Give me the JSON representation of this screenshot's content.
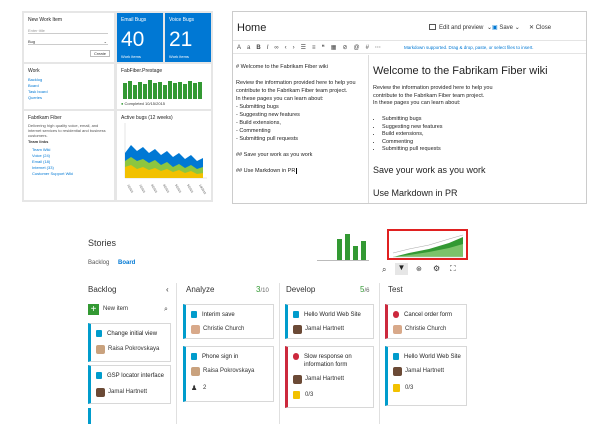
{
  "dashboard": {
    "new_work_item": {
      "title": "New Work Item",
      "placeholder": "Enter title",
      "type": "Bug",
      "button": "Create"
    },
    "email_bugs": {
      "title": "Email Bugs",
      "value": "40",
      "sub": "Work items"
    },
    "voice_bugs": {
      "title": "Voice Bugs",
      "value": "21",
      "sub": "Work items"
    },
    "work": {
      "title": "Work",
      "links": [
        "Backlog",
        "Board",
        "Task board",
        "Queries"
      ]
    },
    "build": {
      "title": "FabFiber.Prestage",
      "status": "Completed 10/15/2015"
    },
    "fabrikam": {
      "title": "Fabrikam Fiber",
      "desc": "Delivering high quality voice, email, and internet services to residential and business customers.",
      "team_links_label": "Team links",
      "links": [
        "Team Wiki",
        "Voice (24)",
        "Email (18)",
        "Internet (33)",
        "Customer Support Wiki"
      ]
    },
    "active_bugs": {
      "title": "Active bugs (12 weeks)"
    }
  },
  "wiki": {
    "title": "Home",
    "edit_preview": "Edit and preview",
    "save": "Save",
    "close": "Close",
    "toolbar_hint": "Markdown supported. Drag & drop, paste, or select files to insert.",
    "editor_lines": [
      "# Welcome to the Fabrikam Fiber wiki",
      "",
      "Review the information provided here to help you",
      "contribute to the Fabrikam Fiber team project.",
      "In these pages you can learn about:",
      "- Submitting bugs",
      "- Suggesting new features",
      "- Build extensions,",
      "- Commenting",
      "- Submitting pull requests",
      "",
      "## Save your work as you work",
      "",
      "## Use Markdown in PR"
    ],
    "preview": {
      "h1": "Welcome to the Fabrikam Fiber wiki",
      "para": [
        "Review the information provided here to help you",
        "contribute to the Fabrikam Fiber team project.",
        "In these pages you can learn about:"
      ],
      "bullets": [
        "Submitting bugs",
        "Suggesting new features",
        "Build extensions,",
        "Commenting",
        "Submitting pull requests"
      ],
      "h2a": "Save your work as you work",
      "h2b": "Use Markdown in PR"
    }
  },
  "stories": {
    "title": "Stories",
    "tabs": [
      "Backlog",
      "Board"
    ],
    "columns": {
      "backlog": {
        "label": "Backlog",
        "new_item": "New item"
      },
      "analyze": {
        "label": "Analyze",
        "count": "3",
        "limit": "/10"
      },
      "develop": {
        "label": "Develop",
        "count": "5",
        "limit": "/6"
      },
      "test": {
        "label": "Test"
      }
    },
    "cards": {
      "b1": {
        "title": "Change initial view",
        "person": "Raisa Pokrovskaya"
      },
      "b2": {
        "title": "GSP locator interface",
        "person": "Jamal Hartnett"
      },
      "a1": {
        "title": "Interim save",
        "person": "Christie Church"
      },
      "a2": {
        "title": "Phone sign in",
        "person": "Raisa Pokrovskaya",
        "tasks": "2"
      },
      "d1": {
        "title": "Hello World Web Site",
        "person": "Jamal Hartnett"
      },
      "d2": {
        "title": "Slow response on",
        "title2": "information form",
        "person": "Jamal Hartnett",
        "tasks": "0/3"
      },
      "t1": {
        "title": "Cancel order form",
        "person": "Christie Church"
      },
      "t2": {
        "title": "Hello World Web Site",
        "person": "Jamal Hartnett",
        "tasks": "0/3"
      }
    }
  },
  "colors": {
    "accent": "#0078d4",
    "story": "#009ccc",
    "bug": "#cc293d",
    "green": "#339933",
    "highlight_red": "#e02020"
  }
}
